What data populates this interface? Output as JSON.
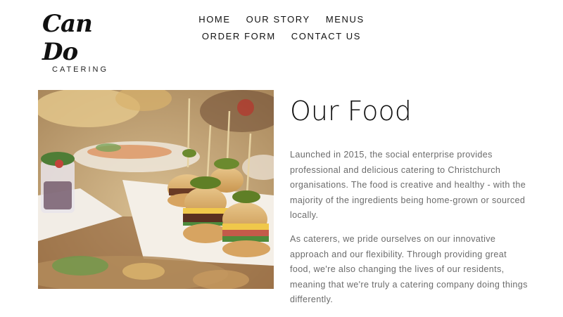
{
  "logo": {
    "main": "Can Do",
    "sub": "CATERING"
  },
  "nav": {
    "row1": [
      "HOME",
      "OUR STORY",
      "MENUS"
    ],
    "row2": [
      "ORDER FORM",
      "CONTACT US"
    ]
  },
  "main": {
    "title": "Our Food",
    "paragraph1": "Launched in 2015, the social enterprise provides professional and delicious catering to Christchurch organisations. The food is creative and healthy - with the majority of the ingredients being home-grown or sourced locally.",
    "paragraph2": "As caterers, we pride ourselves on our innovative approach and our flexibility. Through providing great food, we're also changing the lives of our residents, meaning that we're truly a catering company doing things differently."
  },
  "colors": {
    "text": "#111111",
    "body_text": "#6b6b6b"
  }
}
